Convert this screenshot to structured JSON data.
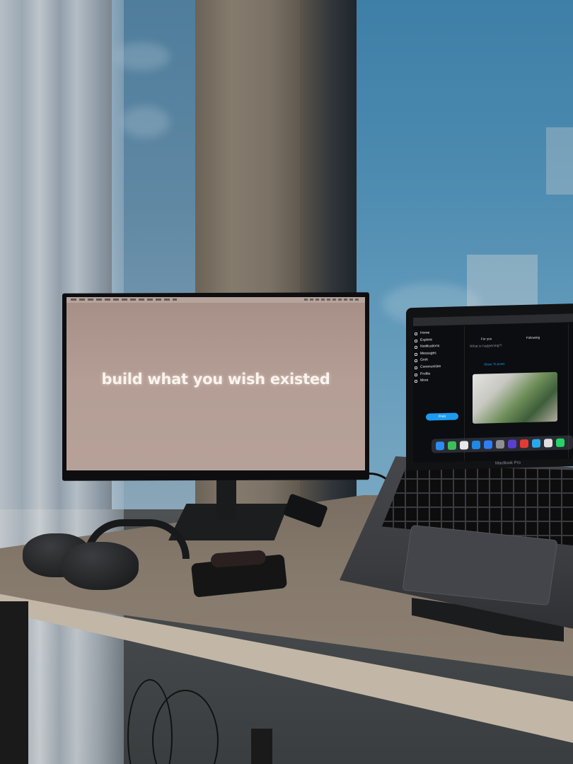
{
  "scene": {
    "description_colors": {
      "sky": "#4d8bb0",
      "desk": "#867a6d",
      "monitor_wallpaper": "#b49e95",
      "x_accent": "#1d9bf0"
    }
  },
  "monitor": {
    "wallpaper_text": "build what you wish existed"
  },
  "laptop": {
    "brand_label": "MacBook Pro",
    "x_app": {
      "tabs": [
        "For you",
        "Following"
      ],
      "nav": [
        "Home",
        "Explore",
        "Notifications",
        "Messages",
        "Grok",
        "Communities",
        "Profile",
        "More"
      ],
      "post_button": "Post",
      "compose_placeholder": "What is happening?!",
      "show_posts": "Show 70 posts"
    },
    "dock_icons": [
      "finder-icon",
      "messages-icon",
      "photos-icon",
      "app-store-icon",
      "safari-icon",
      "settings-icon",
      "shop-icon",
      "chrome-icon",
      "telegram-icon",
      "slack-icon",
      "whatsapp-icon"
    ],
    "dock_colors": [
      "#2d8cf0",
      "#3bc15a",
      "#e8e8e8",
      "#1e88e5",
      "#2f7df6",
      "#8e8e93",
      "#5b3fd1",
      "#e53935",
      "#29a9eb",
      "#e0e0e0",
      "#25d366"
    ]
  }
}
